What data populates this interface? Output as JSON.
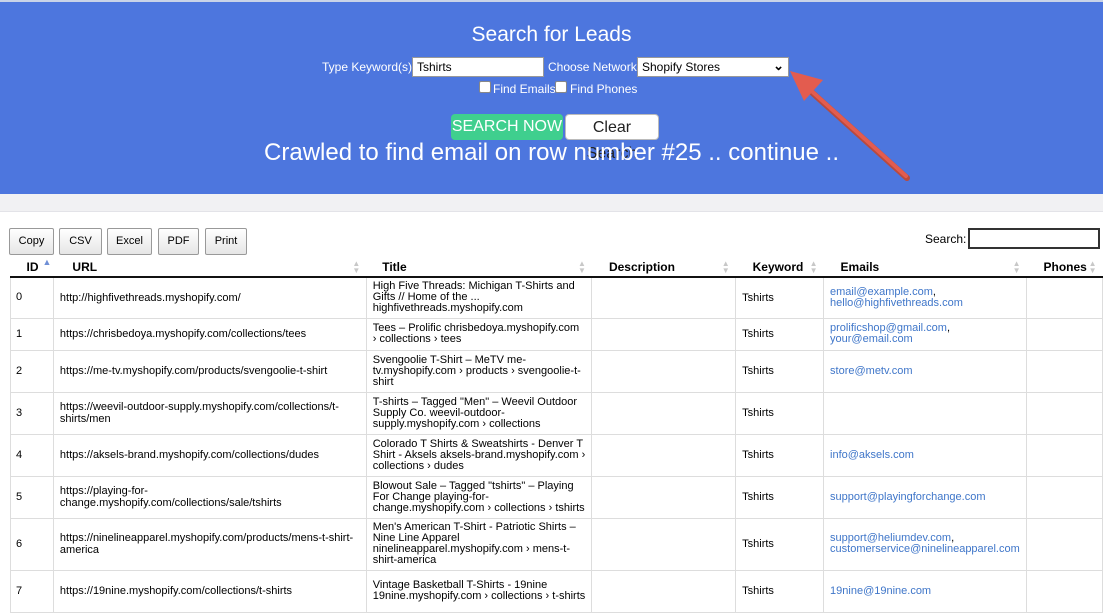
{
  "header": {
    "title": "Search for Leads",
    "keyword_label": "Type Keyword(s):",
    "keyword_value": "Tshirts",
    "network_label": "Choose Network:",
    "network_value": "Shopify Stores",
    "find_emails_label": "Find Emails",
    "find_phones_label": "Find Phones",
    "search_button": "SEARCH NOW",
    "clear_button": "Clear Search",
    "status": "Crawled to find email on row number #25 .. continue .."
  },
  "toolbar": {
    "buttons": [
      "Copy",
      "CSV",
      "Excel",
      "PDF",
      "Print"
    ],
    "search_label": "Search:"
  },
  "colors": {
    "hero": "#4d76de",
    "search_button": "#3fcf8e",
    "arrow": "#e35c4f",
    "link": "#3f76c9"
  },
  "table": {
    "columns": [
      "ID",
      "URL",
      "Title",
      "Description",
      "Keyword",
      "Emails",
      "Phones"
    ],
    "rows": [
      {
        "id": "0",
        "url": "http://highfivethreads.myshopify.com/",
        "title": "High Five Threads: Michigan T-Shirts and Gifts // Home of the ... highfivethreads.myshopify.com",
        "description": "",
        "keyword": "Tshirts",
        "emails": [
          "email@example.com",
          "hello@highfivethreads.com"
        ],
        "phones": ""
      },
      {
        "id": "1",
        "url": "https://chrisbedoya.myshopify.com/collections/tees",
        "title": "Tees – Prolific chrisbedoya.myshopify.com › collections › tees",
        "description": "",
        "keyword": "Tshirts",
        "emails": [
          "prolificshop@gmail.com",
          "your@email.com"
        ],
        "phones": ""
      },
      {
        "id": "2",
        "url": "https://me-tv.myshopify.com/products/svengoolie-t-shirt",
        "title": "Svengoolie T-Shirt – MeTV me-tv.myshopify.com › products › svengoolie-t-shirt",
        "description": "",
        "keyword": "Tshirts",
        "emails": [
          "store@metv.com"
        ],
        "phones": ""
      },
      {
        "id": "3",
        "url": "https://weevil-outdoor-supply.myshopify.com/collections/t-shirts/men",
        "title": "T-shirts – Tagged \"Men\" – Weevil Outdoor Supply Co. weevil-outdoor-supply.myshopify.com › collections",
        "description": "",
        "keyword": "Tshirts",
        "emails": [],
        "phones": ""
      },
      {
        "id": "4",
        "url": "https://aksels-brand.myshopify.com/collections/dudes",
        "title": "Colorado T Shirts & Sweatshirts - Denver T Shirt - Aksels aksels-brand.myshopify.com › collections › dudes",
        "description": "",
        "keyword": "Tshirts",
        "emails": [
          "info@aksels.com"
        ],
        "phones": ""
      },
      {
        "id": "5",
        "url": "https://playing-for-change.myshopify.com/collections/sale/tshirts",
        "title": "Blowout Sale – Tagged \"tshirts\" – Playing For Change playing-for-change.myshopify.com › collections › tshirts",
        "description": "",
        "keyword": "Tshirts",
        "emails": [
          "support@playingforchange.com"
        ],
        "phones": ""
      },
      {
        "id": "6",
        "url": "https://ninelineapparel.myshopify.com/products/mens-t-shirt-america",
        "title": "Men's American T-Shirt - Patriotic Shirts – Nine Line Apparel ninelineapparel.myshopify.com › mens-t-shirt-america",
        "description": "",
        "keyword": "Tshirts",
        "emails": [
          "support@heliumdev.com",
          "customerservice@ninelineapparel.com"
        ],
        "phones": ""
      },
      {
        "id": "7",
        "url": "https://19nine.myshopify.com/collections/t-shirts",
        "title": "Vintage Basketball T-Shirts - 19nine 19nine.myshopify.com › collections › t-shirts",
        "description": "",
        "keyword": "Tshirts",
        "emails": [
          "19nine@19nine.com"
        ],
        "phones": ""
      }
    ]
  }
}
